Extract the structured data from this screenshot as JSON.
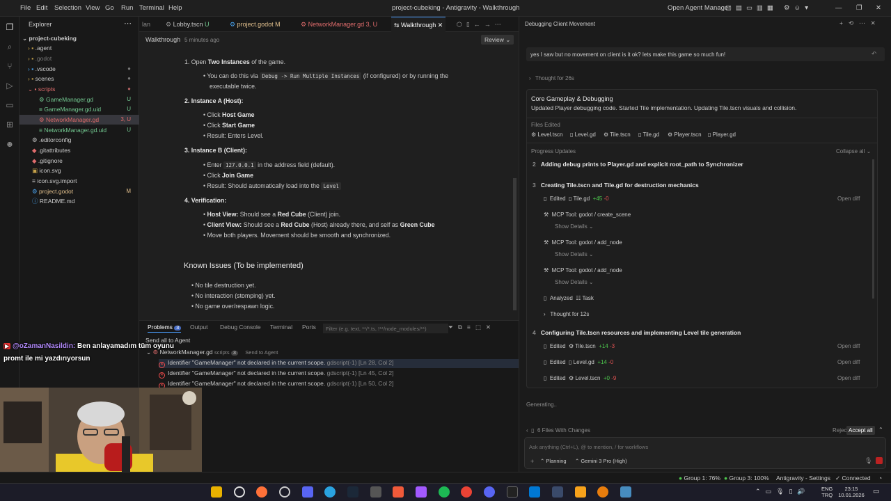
{
  "titlebar": {
    "menus": [
      "File",
      "Edit",
      "Selection",
      "View",
      "Go",
      "Run",
      "Terminal",
      "Help"
    ],
    "title": "project-cubeking - Antigravity - Walkthrough",
    "open_agent_manager": "Open Agent Manager"
  },
  "explorer": {
    "title": "Explorer",
    "root": "project-cubeking",
    "items": [
      {
        "label": ".agent",
        "badge": ""
      },
      {
        "label": ".godot",
        "badge": ""
      },
      {
        "label": ".vscode",
        "badge": ""
      },
      {
        "label": "scenes",
        "badge": ""
      },
      {
        "label": "scripts",
        "badge": ""
      },
      {
        "label": "GameManager.gd",
        "badge": "U"
      },
      {
        "label": "GameManager.gd.uid",
        "badge": "U"
      },
      {
        "label": "NetworkManager.gd",
        "badge": "3, U"
      },
      {
        "label": "NetworkManager.gd.uid",
        "badge": "U"
      },
      {
        "label": ".editorconfig",
        "badge": ""
      },
      {
        "label": ".gitattributes",
        "badge": ""
      },
      {
        "label": ".gitignore",
        "badge": ""
      },
      {
        "label": "icon.svg",
        "badge": ""
      },
      {
        "label": "icon.svg.import",
        "badge": ""
      },
      {
        "label": "project.godot",
        "badge": "M"
      },
      {
        "label": "README.md",
        "badge": ""
      }
    ]
  },
  "tabs": [
    {
      "label": "lan",
      "badge": ""
    },
    {
      "label": "Lobby.tscn",
      "badge": "U"
    },
    {
      "label": "project.godot",
      "badge": "M"
    },
    {
      "label": "NetworkManager.gd",
      "badge": "3, U"
    },
    {
      "label": "Walkthrough",
      "badge": ""
    }
  ],
  "editor": {
    "breadcrumb": "Walkthrough",
    "time": "5 minutes ago",
    "review": "Review",
    "step1": "1. Open",
    "step1b": "Two Instances",
    "step1c": "of the game.",
    "step1_note_a": "You can do this via",
    "step1_code": "Debug -> Run Multiple Instances",
    "step1_note_b": "(if configured) or by running the",
    "step1_note_c": "executable twice.",
    "step2": "2. Instance A (Host):",
    "click": "Click",
    "host_game": "Host Game",
    "start_game": "Start Game",
    "s2_result": "Result: Enters Level.",
    "step3": "3. Instance B (Client):",
    "enter": "Enter",
    "ip": "127.0.0.1",
    "in_address": "in the address field (default).",
    "join_game": "Join Game",
    "s3_result": "Result: Should automatically load into the",
    "level_code": "Level",
    "step4": "4. Verification:",
    "host_view": "Host View:",
    "hv_text": "Should see a",
    "red_cube": "Red Cube",
    "hv_end": "(Client) join.",
    "client_view": "Client View:",
    "cv_text": "Should see a",
    "cv_mid": "(Host) already there, and self as",
    "green_cube": "Green Cube",
    "move_both": "Move both players. Movement should be smooth and synchronized.",
    "known_issues": "Known Issues (To be implemented)",
    "issues": [
      "No tile destruction yet.",
      "No interaction (stomping) yet.",
      "No game over/respawn logic."
    ]
  },
  "panel": {
    "tabs": [
      "Problems",
      "Output",
      "Debug Console",
      "Terminal",
      "Ports"
    ],
    "problems_count": "3",
    "filter_placeholder": "Filter (e.g. text, **/*.ts, !**/node_modules/**)",
    "send_all": "Send all to Agent",
    "file": "NetworkManager.gd",
    "folder": "scripts",
    "file_count": "3",
    "send_to_agent": "Send to Agent",
    "errors": [
      {
        "msg": "Identifier \"GameManager\" not declared in the current scope.",
        "src": "gdscript(-1)",
        "loc": "[Ln 28, Col 2]"
      },
      {
        "msg": "Identifier \"GameManager\" not declared in the current scope.",
        "src": "gdscript(-1)",
        "loc": "[Ln 45, Col 2]"
      },
      {
        "msg": "Identifier \"GameManager\" not declared in the current scope.",
        "src": "gdscript(-1)",
        "loc": "[Ln 50, Col 2]"
      }
    ]
  },
  "chat_overlay": {
    "user": "@oZamanNasildin:",
    "message_a": "Ben anlayamadım tüm oyunu",
    "message_b": "promt ile mi yazdırıyorsun"
  },
  "agent": {
    "title": "Debugging Client Movement",
    "user_msg": "yes I saw but no movement on client is it ok? lets make this game so much fun!",
    "thought": "Thought for 26s",
    "card_title": "Core Gameplay & Debugging",
    "card_desc": "Updated Player debugging code. Started Tile implementation. Updating Tile.tscn visuals and collision.",
    "files_edited": "Files Edited",
    "files": [
      "Level.tscn",
      "Level.gd",
      "Tile.tscn",
      "Tile.gd",
      "Player.tscn",
      "Player.gd"
    ],
    "progress": "Progress Updates",
    "collapse": "Collapse all",
    "p2_num": "2",
    "p2": "Adding debug prints to Player.gd and explicit root_path to Synchronizer",
    "p3_num": "3",
    "p3": "Creating Tile.tscn and Tile.gd for destruction mechanics",
    "edited": "Edited",
    "tile_gd": "Tile.gd",
    "tile_gd_add": "+45",
    "tile_gd_del": "-0",
    "open_diff": "Open diff",
    "mcp1": "MCP Tool: godot / create_scene",
    "mcp2": "MCP Tool: godot / add_node",
    "mcp3": "MCP Tool: godot / add_node",
    "show_details": "Show Details",
    "analyzed": "Analyzed",
    "task": "Task",
    "thought12": "Thought for 12s",
    "p4_num": "4",
    "p4": "Configuring Tile.tscn resources and implementing Level tile generation",
    "e1": "Tile.tscn",
    "e1_add": "+14",
    "e1_del": "-3",
    "e2": "Level.gd",
    "e2_add": "+14",
    "e2_del": "-0",
    "e3": "Level.tscn",
    "e3_add": "+0",
    "e3_del": "-9",
    "generating": "Generating..",
    "files_changes": "6 Files With Changes",
    "reject_all": "Reject all",
    "accept_all": "Accept all",
    "input_placeholder": "Ask anything (Ctrl+L), @ to mention, / for workflows",
    "planning": "Planning",
    "model": "Gemini 3 Pro (High)"
  },
  "statusbar": {
    "group1": "Group 1: 76%",
    "group3": "Group 3: 100%",
    "settings": "Antigravity - Settings",
    "connected": "Connected"
  },
  "taskbar": {
    "lang1": "ENG",
    "lang2": "TRQ",
    "time": "23:15",
    "date": "10.01.2026"
  }
}
